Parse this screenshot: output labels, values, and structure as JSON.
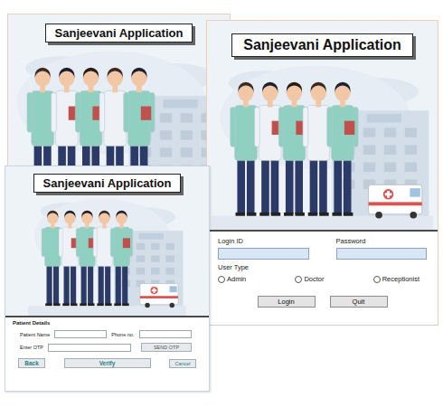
{
  "windows": [
    {
      "kind": "splash",
      "title": "Sanjeevani Application"
    },
    {
      "kind": "login",
      "title": "Sanjeevani Application",
      "fields": [
        {
          "label": "Login ID",
          "value": ""
        },
        {
          "label": "Password",
          "value": ""
        }
      ],
      "user_type": {
        "label": "User Type",
        "options": [
          {
            "label": "Admin",
            "selected": false
          },
          {
            "label": "Doctor",
            "selected": false
          },
          {
            "label": "Receptionist",
            "selected": false
          }
        ]
      },
      "buttons": [
        "Login",
        "Quit"
      ]
    },
    {
      "kind": "patient",
      "title": "Sanjeevani Application",
      "section": "Patient Details",
      "fields": [
        {
          "label": "Patient Name",
          "value": ""
        },
        {
          "label": "Phone no.",
          "value": ""
        },
        {
          "label": "Enter OTP",
          "value": ""
        }
      ],
      "send_button": "SEND OTP",
      "buttons": [
        "Back",
        "Verify",
        "Cancel"
      ]
    }
  ]
}
